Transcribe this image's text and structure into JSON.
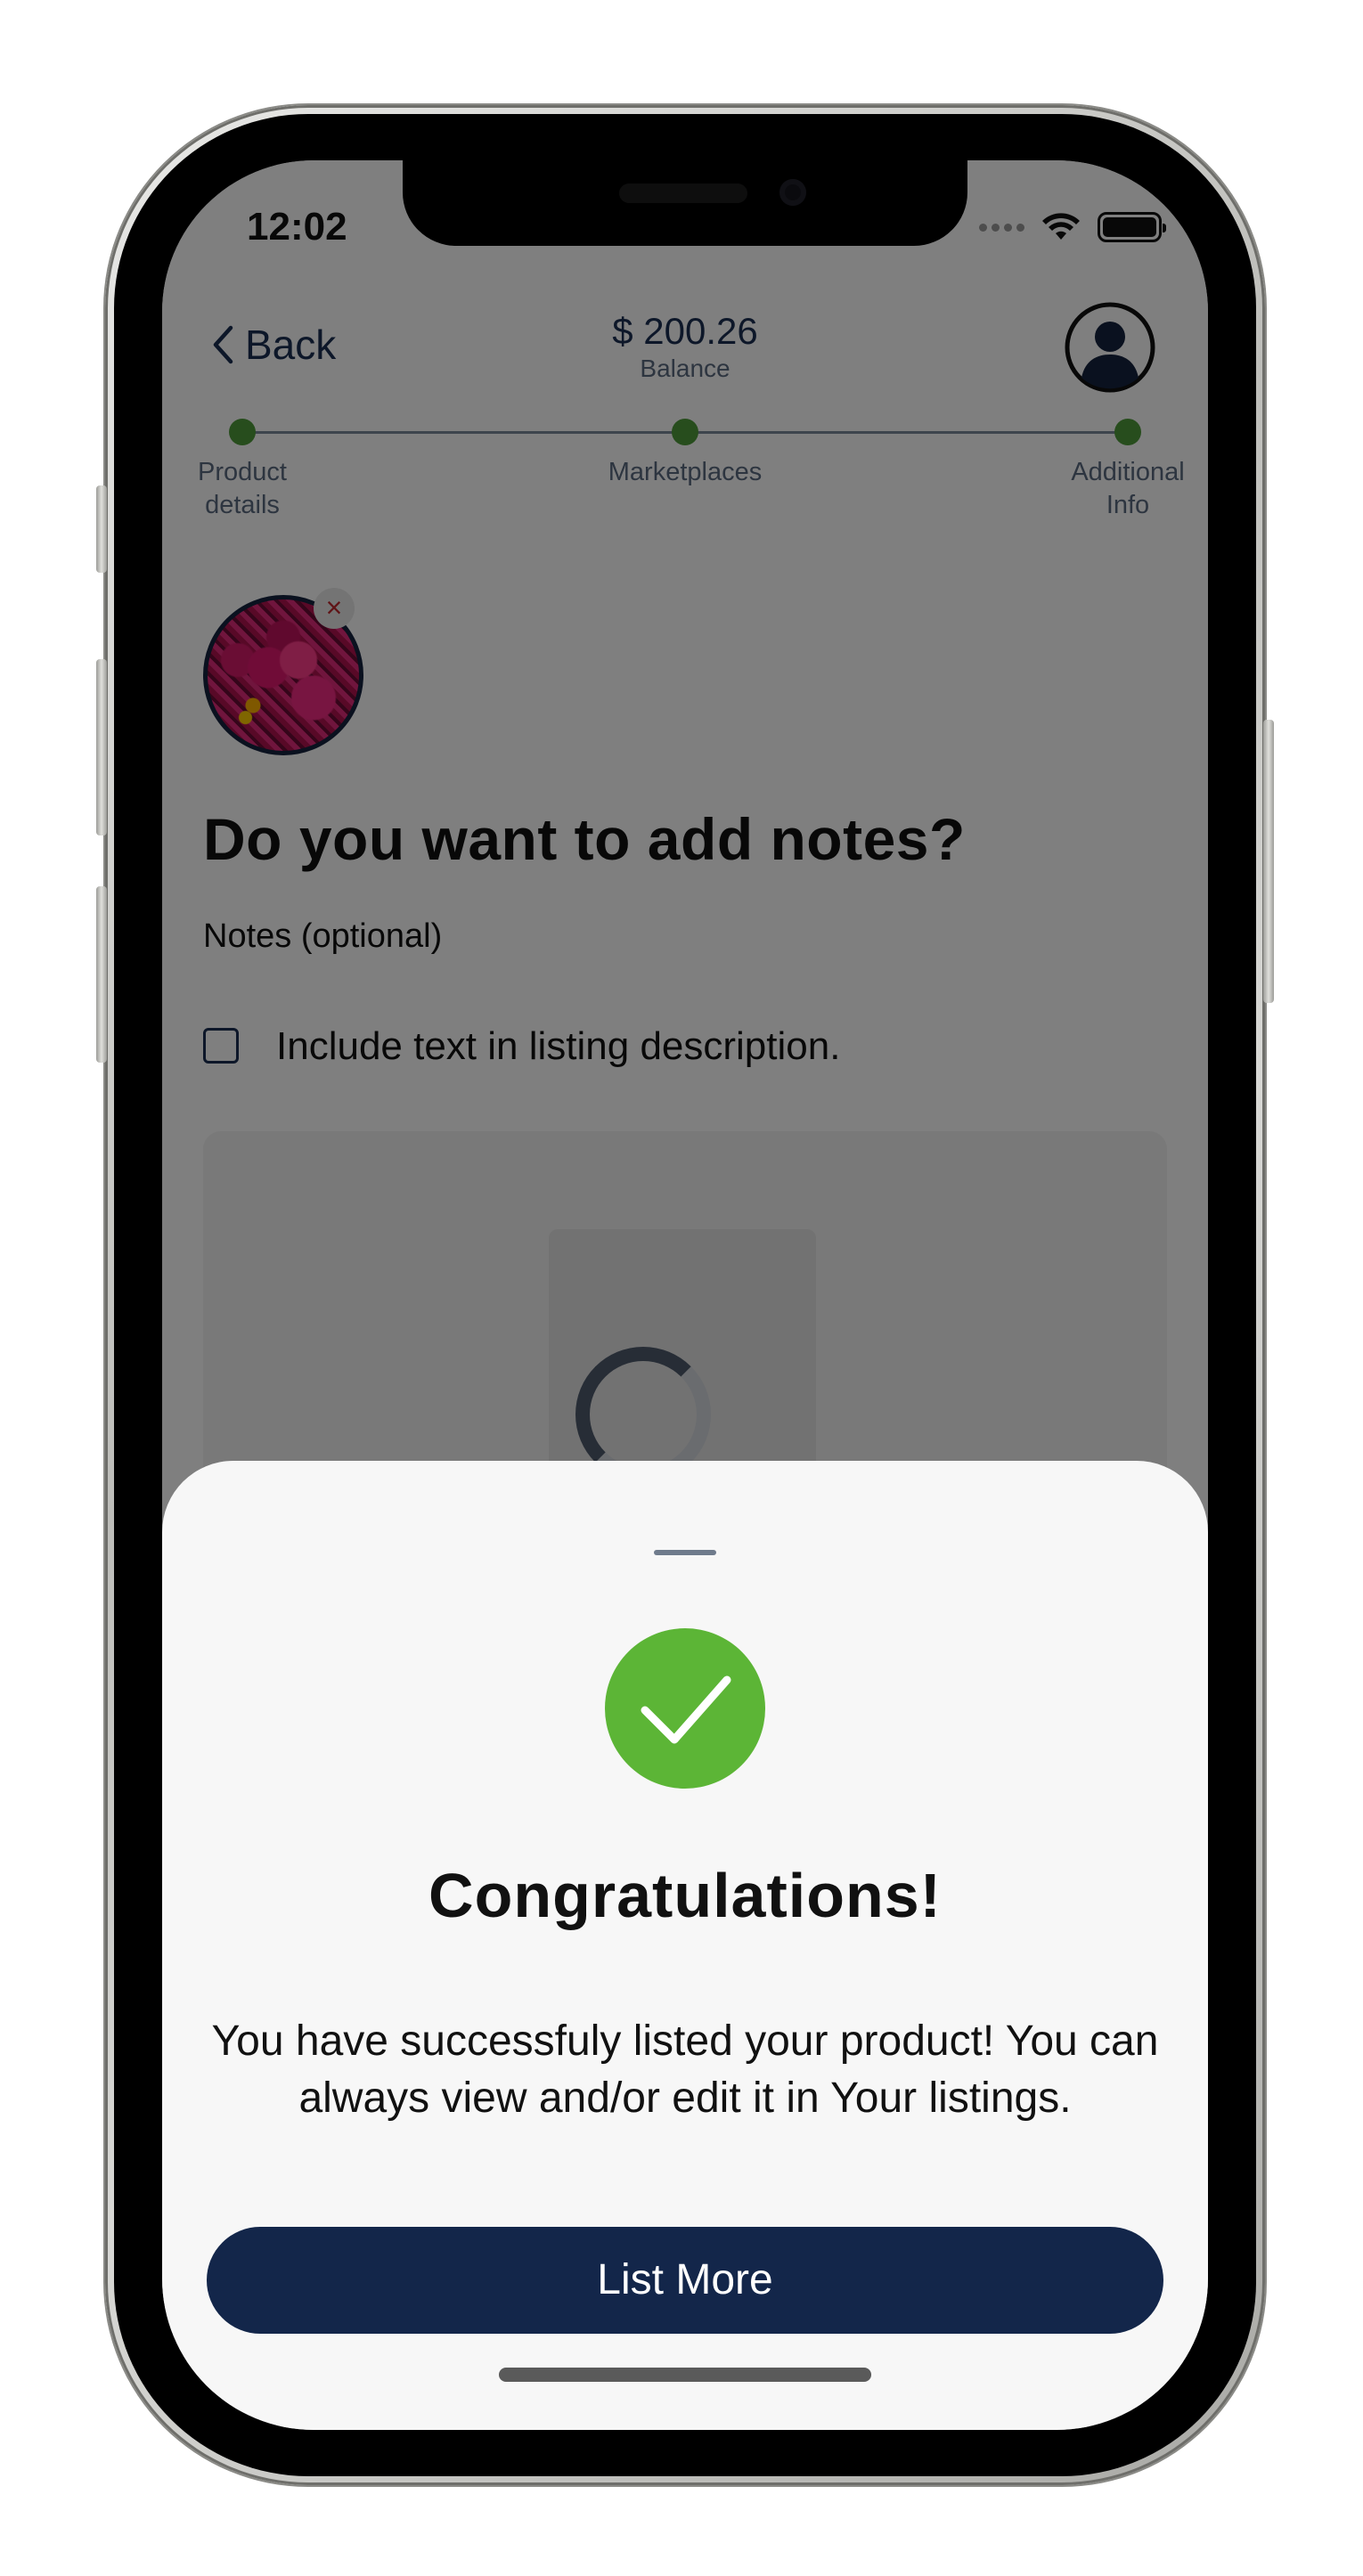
{
  "status_bar": {
    "time": "12:02"
  },
  "header": {
    "back_label": "Back",
    "balance_amount": "$ 200.26",
    "balance_label": "Balance"
  },
  "stepper": {
    "steps": [
      {
        "label": "Product details"
      },
      {
        "label": "Marketplaces"
      },
      {
        "label": "Additional Info"
      }
    ]
  },
  "form": {
    "heading": "Do you want to add notes?",
    "notes_label": "Notes (optional)",
    "include_text_label": "Include text in listing description.",
    "include_text_checked": false
  },
  "sheet": {
    "title": "Congratulations!",
    "message": "You have successfuly listed your product! You can always view and/or edit it in Your listings.",
    "button_label": "List More"
  },
  "colors": {
    "navy": "#13264a",
    "success_green": "#5cb536",
    "step_green": "#4f9a3a"
  }
}
